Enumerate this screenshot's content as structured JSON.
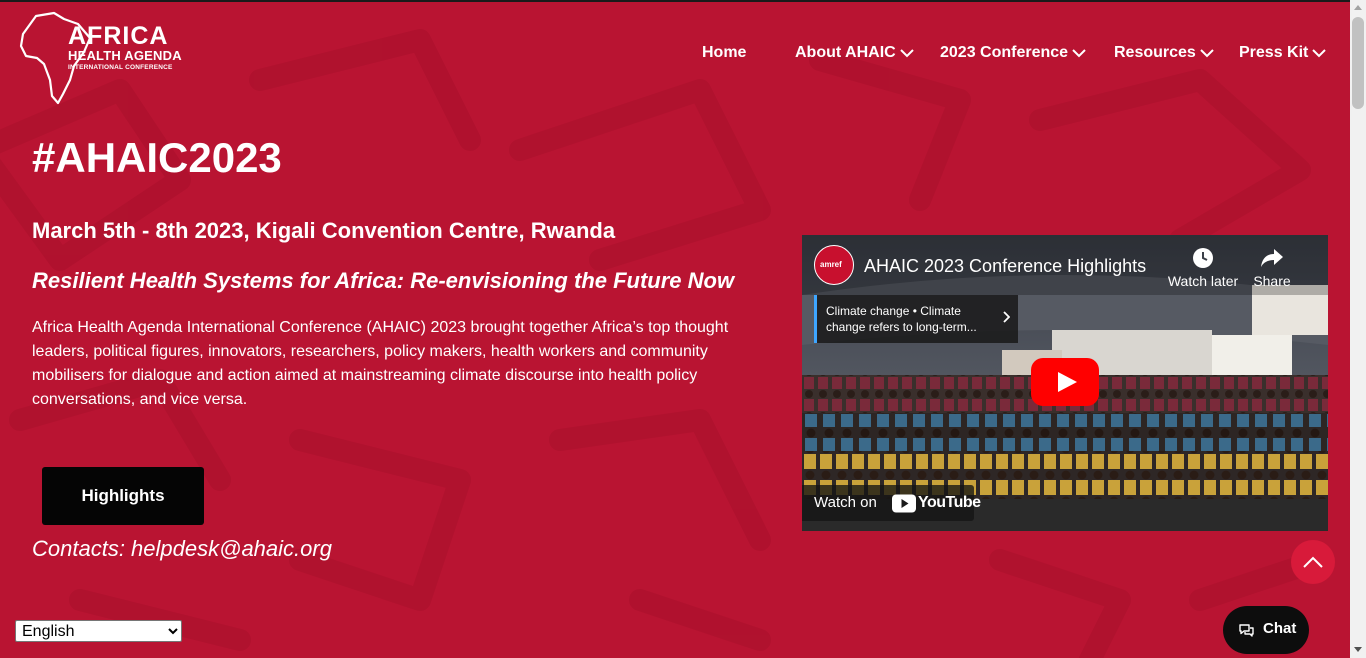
{
  "brand": {
    "line1": "AFRICA",
    "line2": "HEALTH AGENDA",
    "line3": "INTERNATIONAL CONFERENCE"
  },
  "nav": {
    "home": "Home",
    "about": "About AHAIC",
    "conference": "2023 Conference",
    "resources": "Resources",
    "press_kit": "Press Kit"
  },
  "hero": {
    "title": "#AHAIC2023",
    "dates": "March 5th - 8th 2023, Kigali Convention Centre, Rwanda",
    "theme": "Resilient Health Systems for Africa: Re-envisioning the Future Now",
    "description": "Africa Health Agenda International Conference (AHAIC) 2023 brought together Africa’s top thought leaders, political figures, innovators, researchers, policy makers, health workers and community mobilisers for dialogue and action aimed at mainstreaming climate discourse into health policy conversations, and vice versa.",
    "cta_label": "Highlights",
    "contacts": "Contacts: helpdesk@ahaic.org"
  },
  "video": {
    "title": "AHAIC 2023 Conference Highlights",
    "channel_avatar_text": "amref",
    "watch_later": "Watch later",
    "share": "Share",
    "card_text": "Climate change • Climate change refers to long-term...",
    "watch_on": "Watch on",
    "youtube": "YouTube"
  },
  "chat": {
    "label": "Chat"
  },
  "language": {
    "selected": "English"
  },
  "colors": {
    "background": "#b91432",
    "button_dark": "#050505",
    "scroll_top": "#d81a3a",
    "youtube_red": "#ff0000"
  },
  "icons": {
    "nav_dropdown": "chevron-down-icon",
    "scroll_top": "chevron-up-icon",
    "chat": "chat-bubbles-icon",
    "watch_later": "clock-icon",
    "share": "share-arrow-icon",
    "play": "play-icon"
  }
}
